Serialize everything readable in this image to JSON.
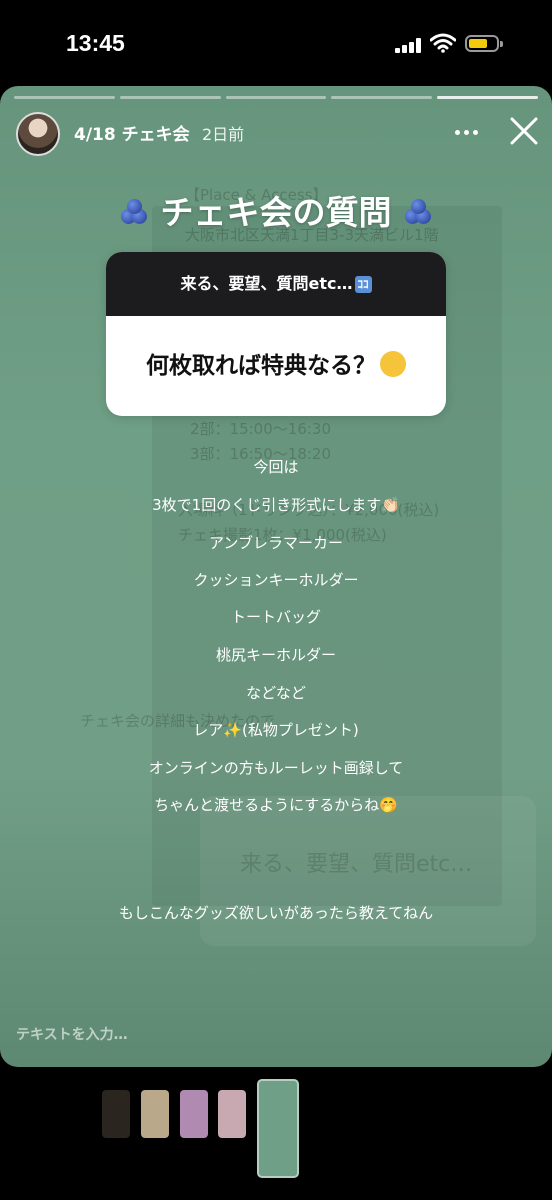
{
  "status_bar": {
    "time": "13:45"
  },
  "story": {
    "username": "4/18 チェキ会",
    "posted": "2日前",
    "title": "チェキ会の質問",
    "question_card": {
      "prompt": "来る、要望、質問etc…",
      "prompt_badge": "ｺｺ",
      "question": "何枚取れば特典なる？"
    },
    "body_lines": [
      "今回は",
      "3枚で1回のくじ引き形式にします👏🏻",
      "アンブレラマーカー",
      "クッションキーホルダー",
      "トートバッグ",
      "桃尻キーホルダー",
      "などなど",
      "レア✨(私物プレゼント)",
      "オンラインの方もルーレット画録して",
      "ちゃんと渡せるようにするからね🤭",
      "もしこんなグッズ欲しいがあったら教えてねん"
    ],
    "reply_placeholder": "テキストを入力…"
  },
  "thumbnails": [
    {
      "name": "story-1",
      "color": "#2b2520"
    },
    {
      "name": "story-2",
      "color": "#b9a88a"
    },
    {
      "name": "story-3",
      "color": "#b08ab0"
    },
    {
      "name": "story-4",
      "color": "#c9a9b1"
    },
    {
      "name": "story-5",
      "color": "#6f9f86",
      "active": true
    }
  ],
  "colors": {
    "story_bg": "#6f9f86",
    "card_header": "#1c1c1e",
    "battery": "#f2cc0c"
  },
  "icons": [
    "signal-icon",
    "wifi-icon",
    "battery-icon",
    "more-icon",
    "close-icon",
    "blueberry-icon",
    "thinking-face-icon"
  ]
}
